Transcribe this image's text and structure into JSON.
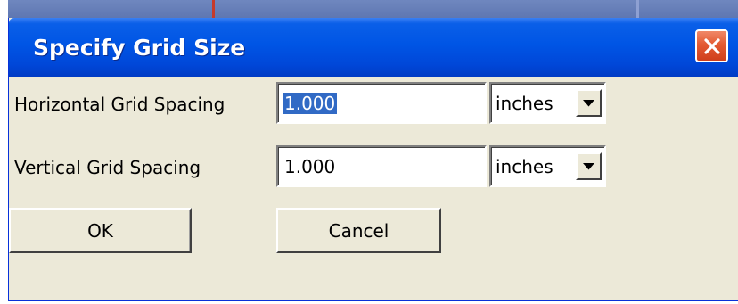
{
  "dialog": {
    "title": "Specify Grid Size",
    "close_icon": "close-icon",
    "title_bar_color": "#0055e5",
    "close_button_color": "#e35a32"
  },
  "fields": {
    "horizontal": {
      "label": "Horizontal Grid Spacing",
      "value": "1.000",
      "unit": "inches",
      "value_selected": true
    },
    "vertical": {
      "label": "Vertical Grid Spacing",
      "value": "1.000",
      "unit": "inches",
      "value_selected": false
    }
  },
  "buttons": {
    "ok_label": "OK",
    "cancel_label": "Cancel"
  },
  "icons": {
    "dropdown": "chevron-down-icon"
  }
}
